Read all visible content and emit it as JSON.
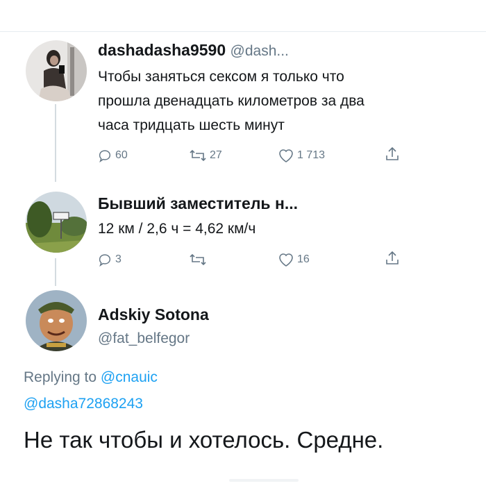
{
  "tweets": [
    {
      "name": "dashadasha9590",
      "handle": "@dash...",
      "text_lines": [
        "Чтобы заняться сексом я только что",
        "прошла двенадцать километров за два",
        "часа тридцать шесть минут"
      ],
      "replies": "60",
      "retweets": "27",
      "likes": "1 713"
    },
    {
      "name": "Бывший заместитель н...",
      "text": "12 км / 2,6 ч = 4,62 км/ч",
      "replies": "3",
      "retweets": "",
      "likes": "16"
    }
  ],
  "main_tweet": {
    "name": "Adskiy Sotona",
    "handle": "@fat_belfegor",
    "replying_prefix": "Replying to",
    "replying_user": "@cnauic",
    "mention": "@dasha72868243",
    "text": "Не так чтобы и хотелось. Средне."
  },
  "colors": {
    "accent": "#1da1f2",
    "secondary_text": "#657786",
    "divider": "#e6ecf0"
  },
  "icons": [
    "reply-icon",
    "retweet-icon",
    "like-icon",
    "share-icon"
  ]
}
